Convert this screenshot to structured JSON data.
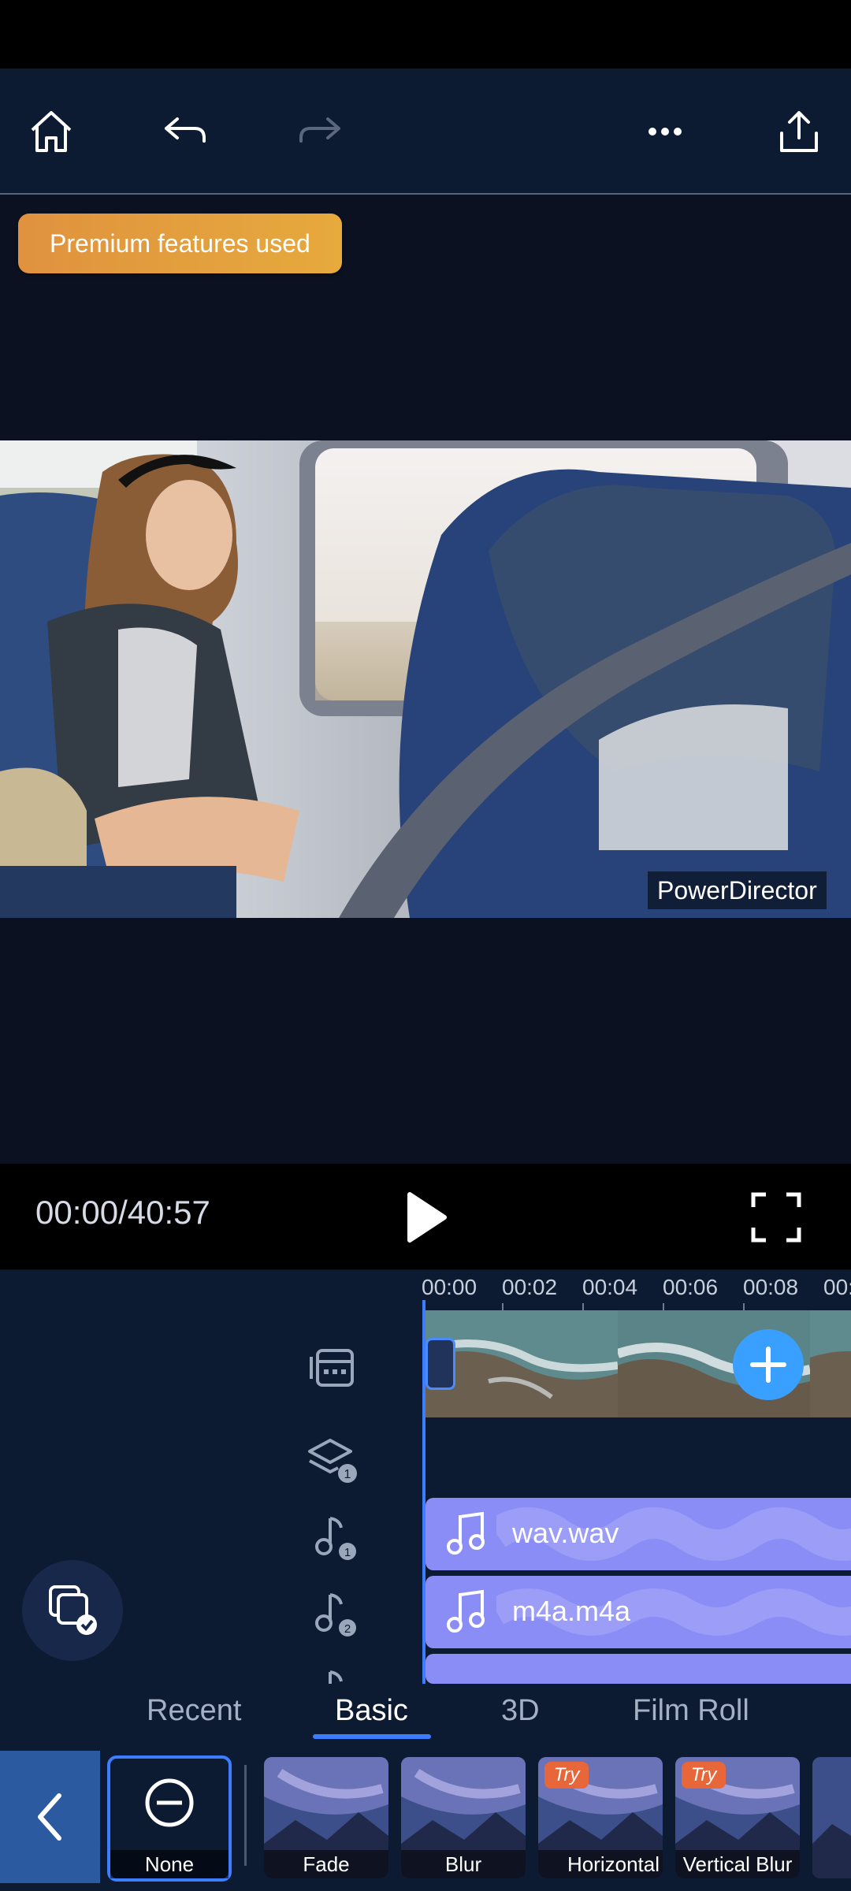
{
  "toolbar": {
    "home": "home-icon",
    "undo": "undo-icon",
    "redo": "redo-icon",
    "more": "more-icon",
    "export": "share-icon"
  },
  "premium_badge": "Premium features used",
  "watermark": "PowerDirector",
  "playback": {
    "timecode": "00:00/40:57"
  },
  "timeline": {
    "ruler": [
      "00:00",
      "00:02",
      "00:04",
      "00:06",
      "00:08",
      "00:1"
    ],
    "audio_tracks": [
      {
        "name": "wav.wav",
        "badge": "1"
      },
      {
        "name": "m4a.m4a",
        "badge": "2"
      }
    ],
    "overlay_badge": "1"
  },
  "transitions": {
    "tabs": [
      "Recent",
      "Basic",
      "3D",
      "Film Roll"
    ],
    "active_tab": "Basic",
    "items": [
      {
        "label": "None",
        "selected": true
      },
      {
        "label": "Fade",
        "try": false
      },
      {
        "label": "Blur",
        "try": false
      },
      {
        "label": "Horizontal",
        "try": true,
        "try_label": "Try"
      },
      {
        "label": "Vertical Blur",
        "try": true,
        "try_label": "Try"
      }
    ]
  },
  "colors": {
    "accent": "#3d7dff",
    "panel": "#0c1a32",
    "premium": "#e0a040",
    "audio_clip": "#8a8df5"
  }
}
